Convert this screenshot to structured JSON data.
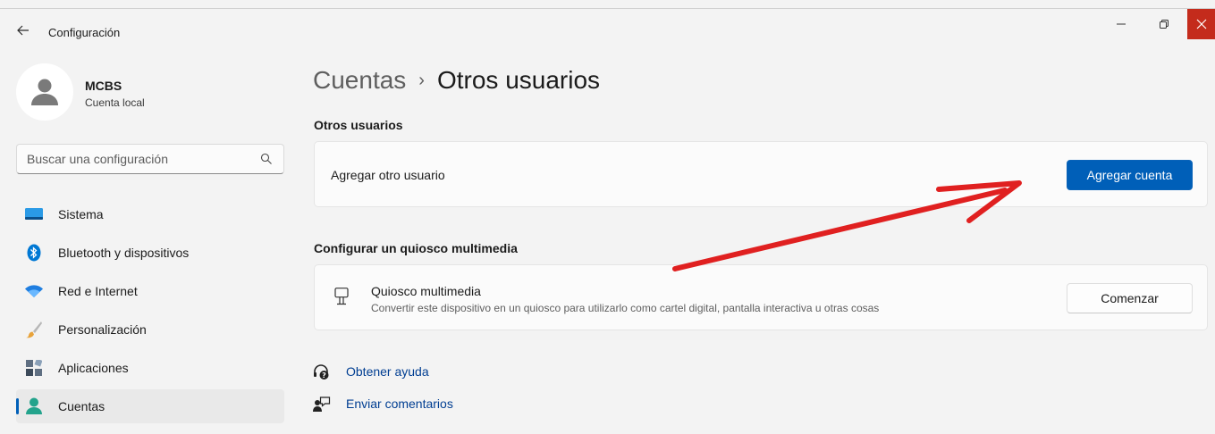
{
  "window": {
    "app_title": "Configuración",
    "close_color": "#c42b1c"
  },
  "profile": {
    "name": "MCBS",
    "account_type": "Cuenta local"
  },
  "search": {
    "placeholder": "Buscar una configuración"
  },
  "sidebar": {
    "items": [
      {
        "label": "Sistema",
        "icon": "monitor-icon"
      },
      {
        "label": "Bluetooth y dispositivos",
        "icon": "bluetooth-icon"
      },
      {
        "label": "Red e Internet",
        "icon": "wifi-icon"
      },
      {
        "label": "Personalización",
        "icon": "brush-icon"
      },
      {
        "label": "Aplicaciones",
        "icon": "apps-icon"
      },
      {
        "label": "Cuentas",
        "icon": "accounts-icon",
        "selected": true
      }
    ]
  },
  "breadcrumb": {
    "parent": "Cuentas",
    "separator": "›",
    "current": "Otros usuarios"
  },
  "other_users": {
    "section_title": "Otros usuarios",
    "row_label": "Agregar otro usuario",
    "button_label": "Agregar cuenta"
  },
  "kiosk": {
    "section_title": "Configurar un quiosco multimedia",
    "title": "Quiosco multimedia",
    "description": "Convertir este dispositivo en un quiosco para utilizarlo como cartel digital, pantalla interactiva u otras cosas",
    "button_label": "Comenzar"
  },
  "help_links": {
    "get_help": "Obtener ayuda",
    "send_feedback": "Enviar comentarios"
  },
  "accent_color": "#005fb8",
  "annotation_arrow_color": "#e02020"
}
